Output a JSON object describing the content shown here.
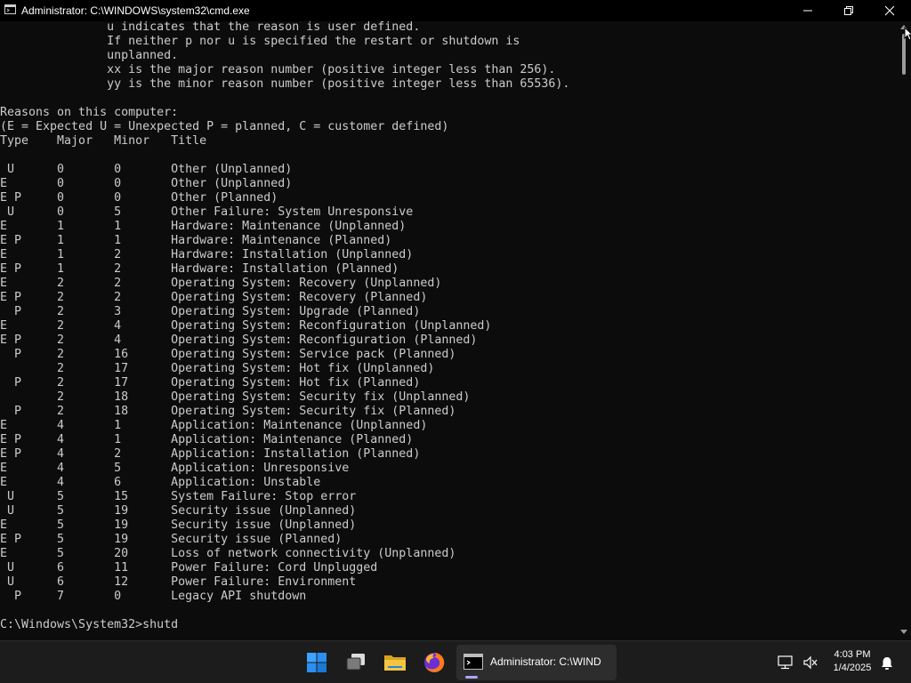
{
  "window": {
    "title": "Administrator: C:\\WINDOWS\\system32\\cmd.exe"
  },
  "terminal": {
    "lines": [
      "               u indicates that the reason is user defined.",
      "               If neither p nor u is specified the restart or shutdown is",
      "               unplanned.",
      "               xx is the major reason number (positive integer less than 256).",
      "               yy is the minor reason number (positive integer less than 65536).",
      "",
      "Reasons on this computer:",
      "(E = Expected U = Unexpected P = planned, C = customer defined)",
      "Type    Major   Minor   Title",
      "",
      " U      0       0       Other (Unplanned)",
      "E       0       0       Other (Unplanned)",
      "E P     0       0       Other (Planned)",
      " U      0       5       Other Failure: System Unresponsive",
      "E       1       1       Hardware: Maintenance (Unplanned)",
      "E P     1       1       Hardware: Maintenance (Planned)",
      "E       1       2       Hardware: Installation (Unplanned)",
      "E P     1       2       Hardware: Installation (Planned)",
      "E       2       2       Operating System: Recovery (Unplanned)",
      "E P     2       2       Operating System: Recovery (Planned)",
      "  P     2       3       Operating System: Upgrade (Planned)",
      "E       2       4       Operating System: Reconfiguration (Unplanned)",
      "E P     2       4       Operating System: Reconfiguration (Planned)",
      "  P     2       16      Operating System: Service pack (Planned)",
      "        2       17      Operating System: Hot fix (Unplanned)",
      "  P     2       17      Operating System: Hot fix (Planned)",
      "        2       18      Operating System: Security fix (Unplanned)",
      "  P     2       18      Operating System: Security fix (Planned)",
      "E       4       1       Application: Maintenance (Unplanned)",
      "E P     4       1       Application: Maintenance (Planned)",
      "E P     4       2       Application: Installation (Planned)",
      "E       4       5       Application: Unresponsive",
      "E       4       6       Application: Unstable",
      " U      5       15      System Failure: Stop error",
      " U      5       19      Security issue (Unplanned)",
      "E       5       19      Security issue (Unplanned)",
      "E P     5       19      Security issue (Planned)",
      "E       5       20      Loss of network connectivity (Unplanned)",
      " U      6       11      Power Failure: Cord Unplugged",
      " U      6       12      Power Failure: Environment",
      "  P     7       0       Legacy API shutdown",
      ""
    ],
    "prompt": "C:\\Windows\\System32>",
    "input": "shutd"
  },
  "taskbar": {
    "active_app_label": "Administrator: C:\\WIND",
    "pinned": [
      "windows-start-icon",
      "task-view-icon",
      "file-explorer-icon",
      "firefox-icon",
      "terminal-icon"
    ]
  },
  "clock": {
    "time": "4:03 PM",
    "date": "1/4/2025"
  },
  "colors": {
    "terminal_bg": "#0c0c0c",
    "terminal_fg": "#cccccc",
    "taskbar_bg": "#1c1c1c",
    "accent": "#0078d4"
  }
}
